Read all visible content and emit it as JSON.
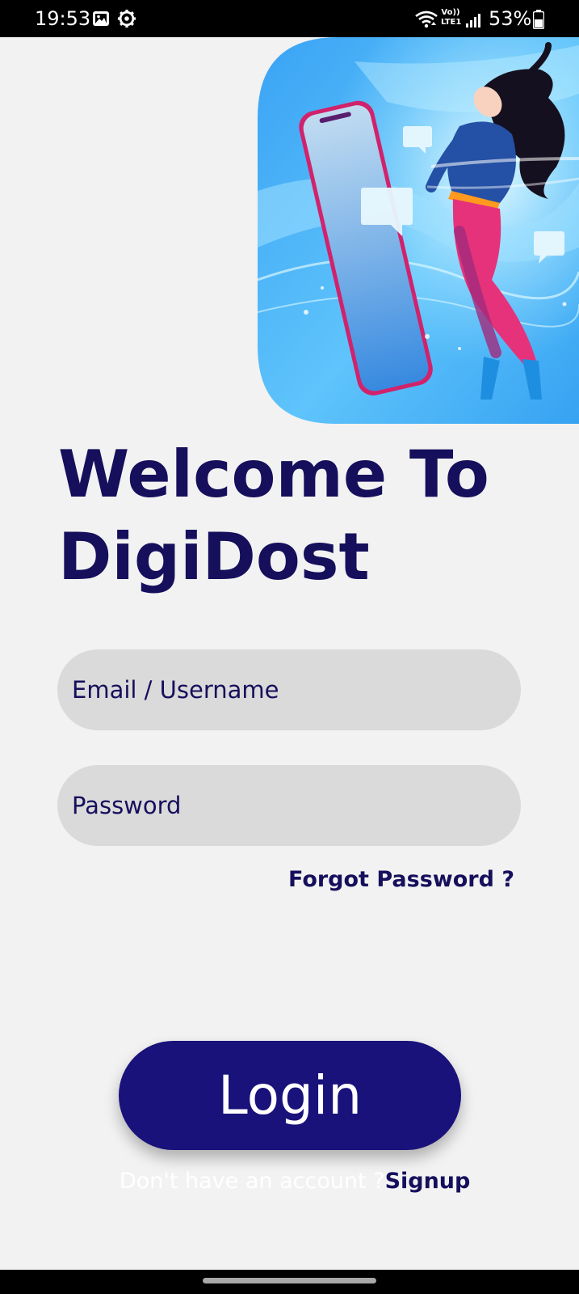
{
  "status_bar": {
    "time": "19:53",
    "icons": [
      "image-icon",
      "settings-icon",
      "wifi-icon",
      "volte-icon",
      "signal-icon"
    ],
    "network_label_top": "Vo))",
    "network_label_bottom": "LTE1",
    "battery_percent": "53%"
  },
  "hero": {
    "description_icon": "phone-and-woman-illustration"
  },
  "welcome": {
    "line1": "Welcome To",
    "line2": "DigiDost"
  },
  "form": {
    "email_placeholder": "Email / Username",
    "password_placeholder": "Password",
    "forgot_password": "Forgot Password ?"
  },
  "actions": {
    "login_label": "Login",
    "signup_prompt": "Don't have an account ?",
    "signup_label": "Signup"
  },
  "colors": {
    "primary": "#19127a",
    "title_text": "#160f5c",
    "background": "#f2f2f2",
    "input_bg": "#dadada"
  }
}
